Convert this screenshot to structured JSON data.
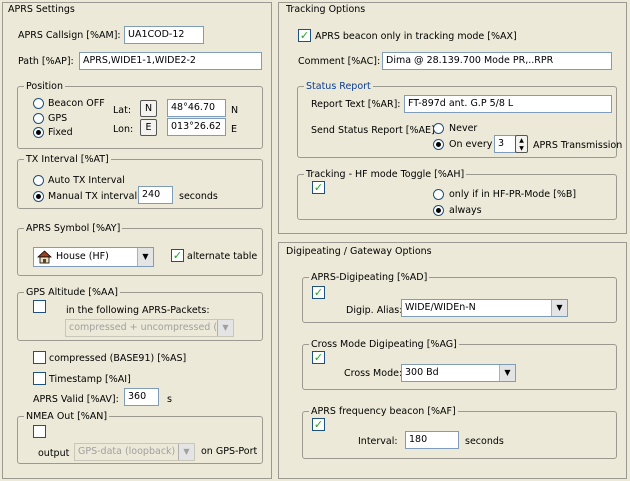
{
  "aprs": {
    "title": "APRS Settings",
    "callsign_label": "APRS Callsign [%AM]:",
    "callsign_value": "UA1COD-12",
    "path_label": "Path [%AP]:",
    "path_value": "APRS,WIDE1-1,WIDE2-2",
    "position": {
      "title": "Position",
      "beacon_off": "Beacon OFF",
      "gps": "GPS",
      "fixed": "Fixed",
      "lat_label": "Lat:",
      "lat_btn": "N",
      "lat_value": "48°46.70",
      "lat_suffix": "N",
      "lon_label": "Lon:",
      "lon_btn": "E",
      "lon_value": "013°26.62",
      "lon_suffix": "E",
      "selected": "Fixed"
    },
    "tx": {
      "title": "TX Interval [%AT]",
      "auto": "Auto TX Interval",
      "manual": "Manual TX interval:",
      "manual_value": "240",
      "seconds": "seconds",
      "selected": "Manual"
    },
    "symbol": {
      "title": "APRS Symbol [%AY]",
      "value": "House (HF)",
      "alt_label": "alternate table",
      "alt_checked": true
    },
    "altitude": {
      "title": "GPS Altitude [%AA]",
      "checked": false,
      "label": "in the following APRS-Packets:",
      "select_value": "compressed + uncompressed (2)"
    },
    "compressed_label": "compressed (BASE91) [%AS]",
    "compressed_checked": false,
    "timestamp_label": "Timestamp [%AI]",
    "timestamp_checked": false,
    "valid_label": "APRS Valid [%AV]:",
    "valid_value": "360",
    "valid_unit": "s",
    "nmea": {
      "title": "NMEA Out [%AN]",
      "checked": false,
      "output_label": "output",
      "output_value": "GPS-data (loopback)",
      "port_label": "on GPS-Port"
    }
  },
  "tracking": {
    "title": "Tracking Options",
    "beacon_only_label": "APRS beacon only in tracking mode [%AX]",
    "beacon_only_checked": true,
    "comment_label": "Comment [%AC]:",
    "comment_value": "Dima @ 28.139.700  Mode  PR,..RPR",
    "status": {
      "title": "Status Report",
      "report_label": "Report Text [%AR]:",
      "report_value": "FT-897d ant. G.P 5/8 L",
      "send_label": "Send Status Report [%AE]:",
      "never": "Never",
      "on_every": "On every",
      "every_value": "3",
      "transmission": "APRS Transmission",
      "selected": "On every"
    },
    "toggle": {
      "title": "Tracking - HF mode Toggle [%AH]",
      "checked": true,
      "only_label": "only if in HF-PR-Mode [%B]",
      "always_label": "always",
      "selected": "always"
    }
  },
  "digi": {
    "title": "Digipeating / Gateway Options",
    "aprs_digi": {
      "title": "APRS-Digipeating [%AD]",
      "checked": true,
      "alias_label": "Digip. Alias:",
      "alias_value": "WIDE/WIDEn-N"
    },
    "cross": {
      "title": "Cross Mode Digipeating [%AG]",
      "checked": true,
      "mode_label": "Cross Mode:",
      "mode_value": "300 Bd"
    },
    "freq": {
      "title": "APRS frequency beacon [%AF]",
      "checked": true,
      "interval_label": "Interval:",
      "interval_value": "180",
      "seconds": "seconds"
    }
  }
}
